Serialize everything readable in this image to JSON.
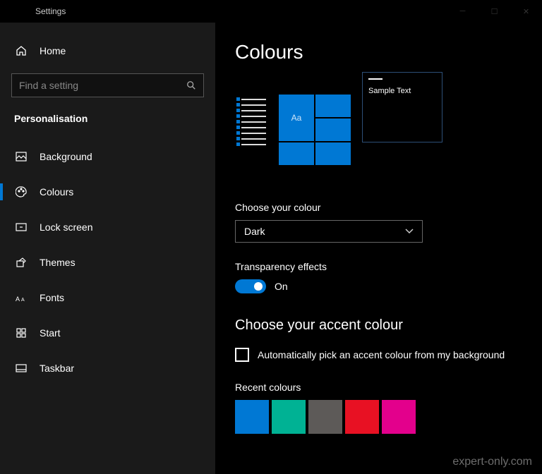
{
  "window": {
    "title": "Settings"
  },
  "sidebar": {
    "home_label": "Home",
    "search_placeholder": "Find a setting",
    "section_title": "Personalisation",
    "items": [
      {
        "label": "Background"
      },
      {
        "label": "Colours"
      },
      {
        "label": "Lock screen"
      },
      {
        "label": "Themes"
      },
      {
        "label": "Fonts"
      },
      {
        "label": "Start"
      },
      {
        "label": "Taskbar"
      }
    ]
  },
  "main": {
    "page_title": "Colours",
    "preview_sample_text": "Sample Text",
    "preview_aa": "Aa",
    "choose_colour_label": "Choose your colour",
    "colour_value": "Dark",
    "transparency_label": "Transparency effects",
    "transparency_value": "On",
    "accent_heading": "Choose your accent colour",
    "auto_pick_label": "Automatically pick an accent colour from my background",
    "recent_label": "Recent colours",
    "recent_colours": [
      "#0078d4",
      "#00b294",
      "#5d5a58",
      "#e81123",
      "#e3008c"
    ]
  },
  "watermark": "expert-only.com"
}
